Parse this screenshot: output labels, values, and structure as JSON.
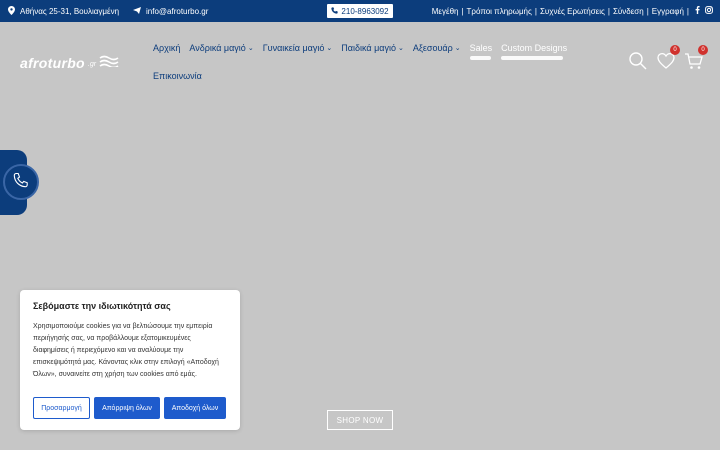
{
  "topbar": {
    "address": "Αθήνας 25-31, Βουλιαγμένη",
    "email": "info@afroturbo.gr",
    "phone": "210-8963092",
    "links": [
      "Μεγέθη",
      "Τρόποι πληρωμής",
      "Συχνές Ερωτήσεις",
      "Σύνδεση",
      "Εγγραφή"
    ]
  },
  "logo": {
    "brand": "afroturbo",
    "suffix": ".gr"
  },
  "nav": {
    "items": [
      {
        "label": "Αρχική"
      },
      {
        "label": "Ανδρικά μαγιό"
      },
      {
        "label": "Γυναικεία μαγιό"
      },
      {
        "label": "Παιδικά μαγιό"
      },
      {
        "label": "Αξεσουάρ"
      },
      {
        "label": "Sales"
      },
      {
        "label": "Custom Designs"
      },
      {
        "label": "Επικοινωνία"
      }
    ]
  },
  "header": {
    "wishlist_count": "0",
    "cart_count": "0"
  },
  "cookie": {
    "title": "Σεβόμαστε την ιδιωτικότητά σας",
    "text": "Χρησιμοποιούμε cookies για να βελτιώσουμε την εμπειρία περιήγησής σας, να προβάλλουμε εξατομικευμένες διαφημίσεις ή περιεχόμενο και να αναλύουμε την επισκεψιμότητά μας. Κάνοντας κλικ στην επιλογή «Αποδοχή Όλων», συναινείτε στη χρήση των cookies από εμάς.",
    "customize": "Προσαρμογή",
    "reject": "Απόρριψη όλων",
    "accept": "Αποδοχή όλων"
  },
  "hero": {
    "cta": "SHOP NOW"
  },
  "colors": {
    "primary": "#0c3d7c",
    "accent": "#1e5bcc",
    "badge": "#d0312d",
    "hero_bg": "#c6c6c6"
  }
}
